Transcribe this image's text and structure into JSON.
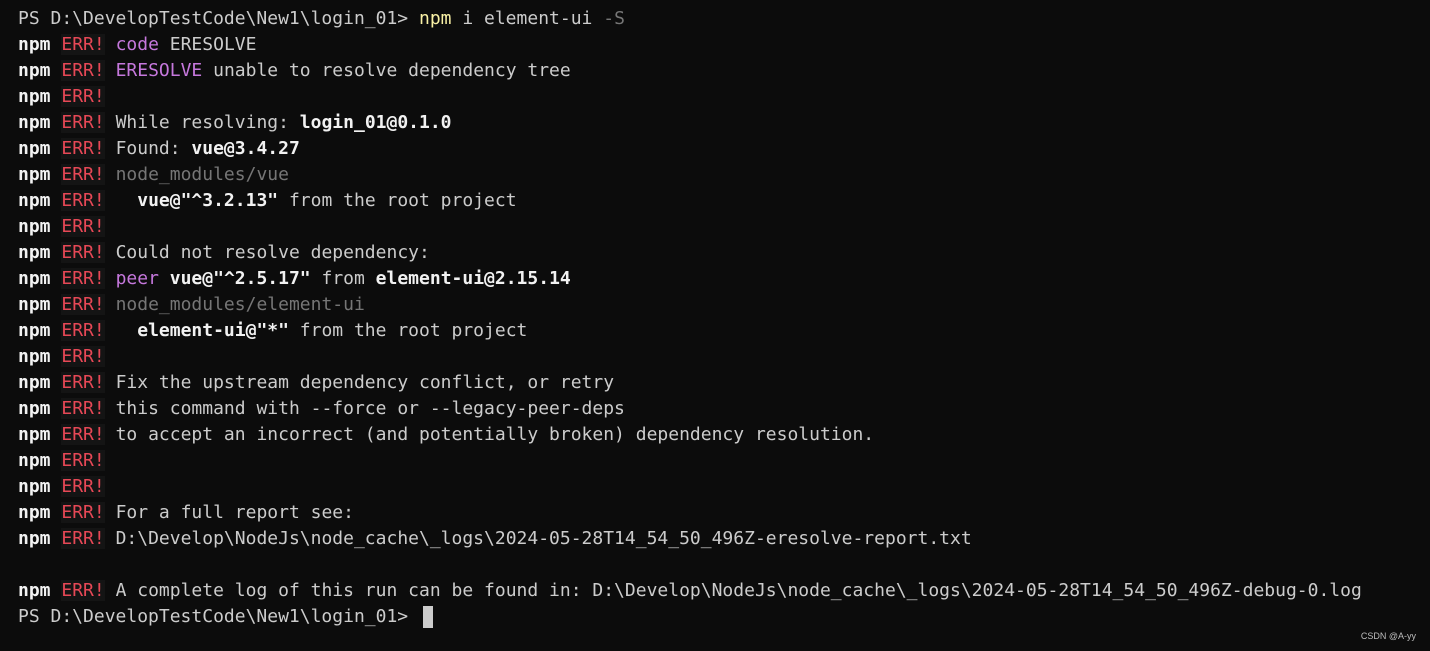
{
  "terminal": {
    "prompt1": "PS D:\\DevelopTestCode\\New1\\login_01>",
    "cmd_npm": "npm",
    "cmd_rest": " i element-ui",
    "cmd_flag": " -S",
    "npm": "npm",
    "err": "ERR!",
    "l1_code": "code",
    "l1_val": " ERESOLVE",
    "l2_eresolve": "ERESOLVE",
    "l2_rest": " unable to resolve dependency tree",
    "l4_label": "While resolving: ",
    "l4_pkg": "login_01@0.1.0",
    "l5_label": "Found: ",
    "l5_pkg": "vue@3.4.27",
    "l6_path": "node_modules/vue",
    "l7_pkg": "  vue@\"^3.2.13\"",
    "l7_rest": " from the root project",
    "l9_text": "Could not resolve dependency:",
    "l10_peer": "peer",
    "l10_pkg": " vue@\"^2.5.17\"",
    "l10_from": " from ",
    "l10_pkg2": "element-ui@2.15.14",
    "l11_path": "node_modules/element-ui",
    "l12_pkg": "  element-ui@\"*\"",
    "l12_rest": " from the root project",
    "l14_text": "Fix the upstream dependency conflict, or retry",
    "l15_text": "this command with --force or --legacy-peer-deps",
    "l16_text": "to accept an incorrect (and potentially broken) dependency resolution.",
    "l19_text": "For a full report see:",
    "l20_text": "D:\\Develop\\NodeJs\\node_cache\\_logs\\2024-05-28T14_54_50_496Z-eresolve-report.txt",
    "l22_text": "A complete log of this run can be found in: D:\\Develop\\NodeJs\\node_cache\\_logs\\2024-05-28T14_54_50_496Z-debug-0.log",
    "prompt2": "PS D:\\DevelopTestCode\\New1\\login_01>"
  },
  "watermark": "CSDN @A-yy"
}
